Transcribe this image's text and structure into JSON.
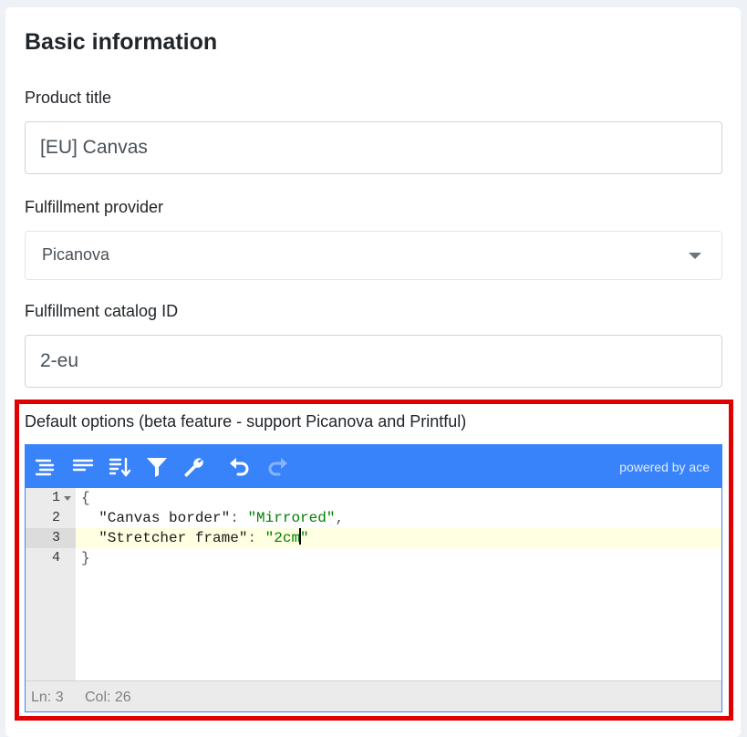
{
  "card": {
    "title": "Basic information"
  },
  "fields": {
    "product_title": {
      "label": "Product title",
      "value": "[EU] Canvas"
    },
    "fulfillment_provider": {
      "label": "Fulfillment provider",
      "selected": "Picanova"
    },
    "catalog_id": {
      "label": "Fulfillment catalog ID",
      "value": "2-eu"
    },
    "default_options": {
      "label": "Default options (beta feature - support Picanova and Printful)"
    }
  },
  "editor": {
    "powered_by": "powered by ace",
    "toolbar_icons": [
      "format-icon",
      "compact-icon",
      "sort-icon",
      "filter-icon",
      "repair-icon",
      "undo-icon",
      "redo-icon"
    ],
    "line_numbers": [
      "1",
      "2",
      "3",
      "4"
    ],
    "lines": {
      "l1": "{",
      "l2_indent": "  ",
      "l2_key": "\"Canvas border\"",
      "l2_colon": ": ",
      "l2_value": "\"Mirrored\"",
      "l2_comma": ",",
      "l3_indent": "  ",
      "l3_key": "\"Stretcher frame\"",
      "l3_colon": ": ",
      "l3_value_before_cursor": "\"2cm",
      "l3_value_after_cursor": "\"",
      "l4": "}"
    },
    "status": {
      "ln": "Ln: 3",
      "col": "Col: 26"
    }
  },
  "colors": {
    "toolbar": "#3883fa",
    "highlight_border": "#e00000",
    "string": "#008000"
  }
}
